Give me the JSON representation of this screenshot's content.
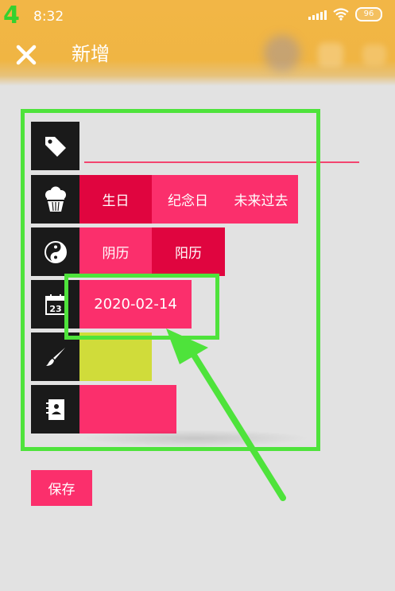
{
  "status_bar": {
    "badge": "4",
    "time": "8:32",
    "battery": "96"
  },
  "header": {
    "title": "新增"
  },
  "form": {
    "name_value": "",
    "type_options": [
      "生日",
      "纪念日",
      "未来过去"
    ],
    "calendar_options": [
      "阴历",
      "阳历"
    ],
    "date_value": "2020-02-14",
    "color_value": "#d0dc3a",
    "note_color": "#fb2f6c"
  },
  "actions": {
    "save_label": "保存"
  },
  "colors": {
    "accent": "#fb2f6c",
    "selected": "#e0053f",
    "header": "#f2b646",
    "highlight": "#4ee33b"
  }
}
